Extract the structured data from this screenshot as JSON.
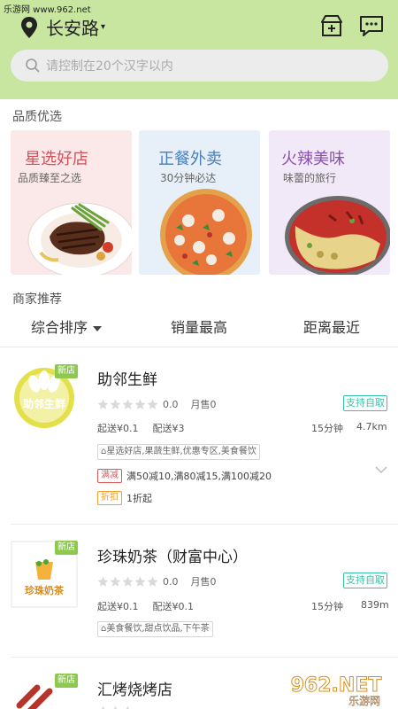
{
  "watermark_top": "乐游网 www.962.net",
  "header": {
    "location": "长安路",
    "search_placeholder": "请控制在20个汉字以内"
  },
  "sections": {
    "quality": "品质优选",
    "merchants": "商家推荐"
  },
  "cards": [
    {
      "title": "星选好店",
      "subtitle": "品质臻至之选",
      "bg": "#fbe9ea",
      "title_color": "#d2505a"
    },
    {
      "title": "正餐外卖",
      "subtitle": "30分钟必达",
      "bg": "#e7eff8",
      "title_color": "#4a7fb8"
    },
    {
      "title": "火辣美味",
      "subtitle": "味蕾的旅行",
      "bg": "#f1e9f7",
      "title_color": "#8a52b0"
    }
  ],
  "filters": [
    "综合排序",
    "销量最高",
    "距离最近"
  ],
  "shops": [
    {
      "badge": "新店",
      "name": "助邻生鲜",
      "logo_text": "助邻生鲜",
      "rating": "0.0",
      "monthly": "月售0",
      "pickup": "支持自取",
      "min_order": "起送¥0.1",
      "delivery_fee": "配送¥3",
      "time": "15分钟",
      "distance": "4.7km",
      "tags": "星选好店,果蔬生鲜,优惠专区,美食餐饮",
      "promos": [
        {
          "tag": "满减",
          "text": "满50减10,满80减15,满100减20",
          "color": "red"
        },
        {
          "tag": "折扣",
          "text": "1折起",
          "color": "orange"
        }
      ]
    },
    {
      "badge": "新店",
      "name": "珍珠奶茶（财富中心）",
      "logo_text": "珍珠奶茶",
      "rating": "0.0",
      "monthly": "月售0",
      "pickup": "支持自取",
      "min_order": "起送¥0.1",
      "delivery_fee": "配送¥0.1",
      "time": "15分钟",
      "distance": "839m",
      "tags": "美食餐饮,甜点饮品,下午茶"
    },
    {
      "badge": "新店",
      "name": "汇烤烧烤店"
    }
  ],
  "watermark_bottom": {
    "brand": "962.NET",
    "sub": "乐游网"
  }
}
